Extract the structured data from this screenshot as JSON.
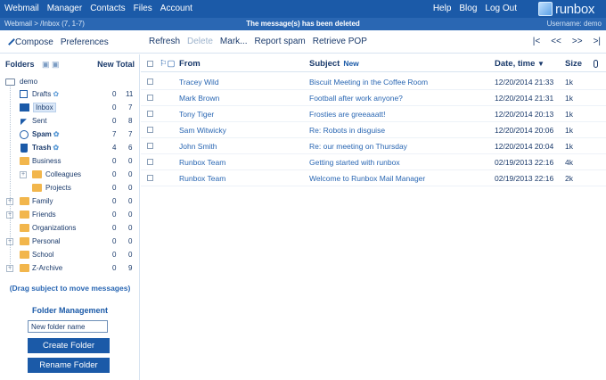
{
  "topnav": {
    "left": [
      "Webmail",
      "Manager",
      "Contacts",
      "Files",
      "Account"
    ],
    "right": [
      "Help",
      "Blog",
      "Log Out"
    ],
    "logo_text": "runbox"
  },
  "subbar": {
    "breadcrumb": "Webmail > /Inbox (7, 1-7)",
    "message": "The message(s) has been deleted",
    "username": "Username: demo"
  },
  "toolbar": {
    "compose": "Compose",
    "preferences": "Preferences",
    "refresh": "Refresh",
    "delete": "Delete",
    "mark": "Mark...",
    "report_spam": "Report spam",
    "retrieve_pop": "Retrieve POP",
    "pager": [
      "|<",
      "<<",
      ">>",
      ">|"
    ]
  },
  "sidebar": {
    "header": "Folders",
    "header_total": "New Total",
    "root": "demo",
    "folders": [
      {
        "name": "Drafts",
        "new": "0",
        "total": "11"
      },
      {
        "name": "Inbox",
        "new": "0",
        "total": "7"
      },
      {
        "name": "Sent",
        "new": "0",
        "total": "8"
      },
      {
        "name": "Spam",
        "new": "7",
        "total": "7"
      },
      {
        "name": "Trash",
        "new": "4",
        "total": "6"
      },
      {
        "name": "Business",
        "new": "0",
        "total": "0"
      },
      {
        "name": "Colleagues",
        "new": "0",
        "total": "0"
      },
      {
        "name": "Projects",
        "new": "0",
        "total": "0"
      },
      {
        "name": "Family",
        "new": "0",
        "total": "0"
      },
      {
        "name": "Friends",
        "new": "0",
        "total": "0"
      },
      {
        "name": "Organizations",
        "new": "0",
        "total": "0"
      },
      {
        "name": "Personal",
        "new": "0",
        "total": "0"
      },
      {
        "name": "School",
        "new": "0",
        "total": "0"
      },
      {
        "name": "Z-Archive",
        "new": "0",
        "total": "9"
      }
    ],
    "drag_hint": "(Drag subject to move messages)",
    "fm_title": "Folder Management",
    "fm_input": "New folder name",
    "create_button": "Create Folder",
    "rename_button": "Rename Folder"
  },
  "list": {
    "columns": {
      "from": "From",
      "subject": "Subject",
      "subject_new": "New",
      "date": "Date, time",
      "date_sort": "▼",
      "size": "Size"
    },
    "rows": [
      {
        "from": "Tracey Wild",
        "subject": "Biscuit Meeting in the Coffee Room",
        "date": "12/20/2014 21:33",
        "size": "1k"
      },
      {
        "from": "Mark Brown",
        "subject": "Football after work anyone?",
        "date": "12/20/2014 21:31",
        "size": "1k"
      },
      {
        "from": "Tony Tiger",
        "subject": "Frosties are greeaaatt!",
        "date": "12/20/2014 20:13",
        "size": "1k"
      },
      {
        "from": "Sam Witwicky",
        "subject": "Re: Robots in disguise",
        "date": "12/20/2014 20:06",
        "size": "1k"
      },
      {
        "from": "John Smith",
        "subject": "Re: our meeting on Thursday",
        "date": "12/20/2014 20:04",
        "size": "1k"
      },
      {
        "from": "Runbox Team",
        "subject": "Getting started with runbox",
        "date": "02/19/2013 22:16",
        "size": "4k"
      },
      {
        "from": "Runbox Team",
        "subject": "Welcome to Runbox Mail Manager",
        "date": "02/19/2013 22:16",
        "size": "2k"
      }
    ]
  }
}
